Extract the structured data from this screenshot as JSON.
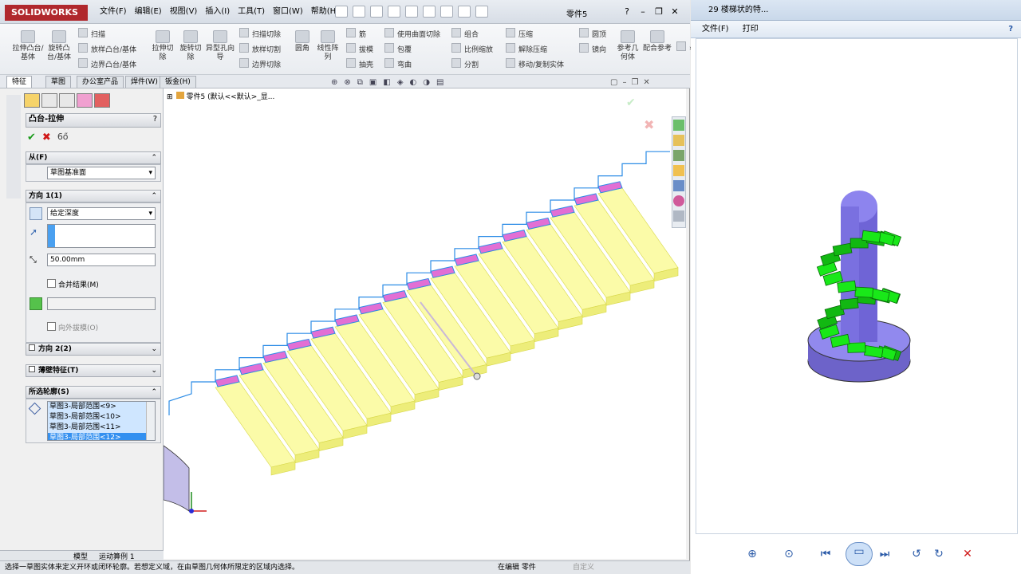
{
  "app": {
    "logo": "SOLIDWORKS",
    "doc_title": "零件5"
  },
  "menu": [
    "文件(F)",
    "编辑(E)",
    "视图(V)",
    "插入(I)",
    "工具(T)",
    "窗口(W)",
    "帮助(H)"
  ],
  "ribbon": {
    "large": [
      "拉伸凸台/基体",
      "旋转凸台/基体",
      "拉伸切除",
      "旋转切除",
      "异型孔向导",
      "圆角",
      "线性阵列",
      "参考几何体",
      "配合参考"
    ],
    "small": [
      "扫描",
      "放样凸台/基体",
      "边界凸台/基体",
      "扫描切除",
      "放样切割",
      "边界切除",
      "筋",
      "拔模",
      "抽壳",
      "使用曲面切除",
      "包覆",
      "弯曲",
      "组合",
      "比例缩放",
      "分割",
      "压缩",
      "解除压缩",
      "移动/复制实体",
      "圆顶",
      "镜向"
    ]
  },
  "tabs": [
    "特征",
    "草图",
    "办公室产品",
    "焊件(W)",
    "钣金(H)"
  ],
  "tree": {
    "title": "零件5 (默认<<默认>_显..."
  },
  "property_manager": {
    "title": "凸台-拉伸",
    "help": "?",
    "from_header": "从(F)",
    "from_value": "草图基准面",
    "dir1_header": "方向 1(1)",
    "end_condition": "给定深度",
    "depth": "50.00mm",
    "merge_label": "合并结果(M)",
    "draft_label": "向外拔模(O)",
    "dir2_header": "方向 2(2)",
    "thin_header": "薄壁特征(T)",
    "contours_header": "所选轮廓(S)",
    "contours": [
      "草图3-局部范围<9>",
      "草图3-局部范围<10>",
      "草图3-局部范围<11>",
      "草图3-局部范围<12>"
    ]
  },
  "bottom_tabs": [
    "模型",
    "运动算例 1"
  ],
  "status": {
    "hint": "选择一草图实体来定义开环或闭环轮廓。若想定义域，在由草图几何体所限定的区域内选择。",
    "mode": "在编辑 零件",
    "custom": "自定义"
  },
  "viewer": {
    "title": "29 楼梯状的特...",
    "menu": [
      "文件(F)",
      "打印"
    ],
    "help": "?"
  },
  "colors": {
    "stair_fill": "#fbfba8",
    "profile_pink": "#e26fd4",
    "sketch_blue": "#2c8ce6",
    "column": "#8476e6",
    "spiral": "#19e819"
  }
}
